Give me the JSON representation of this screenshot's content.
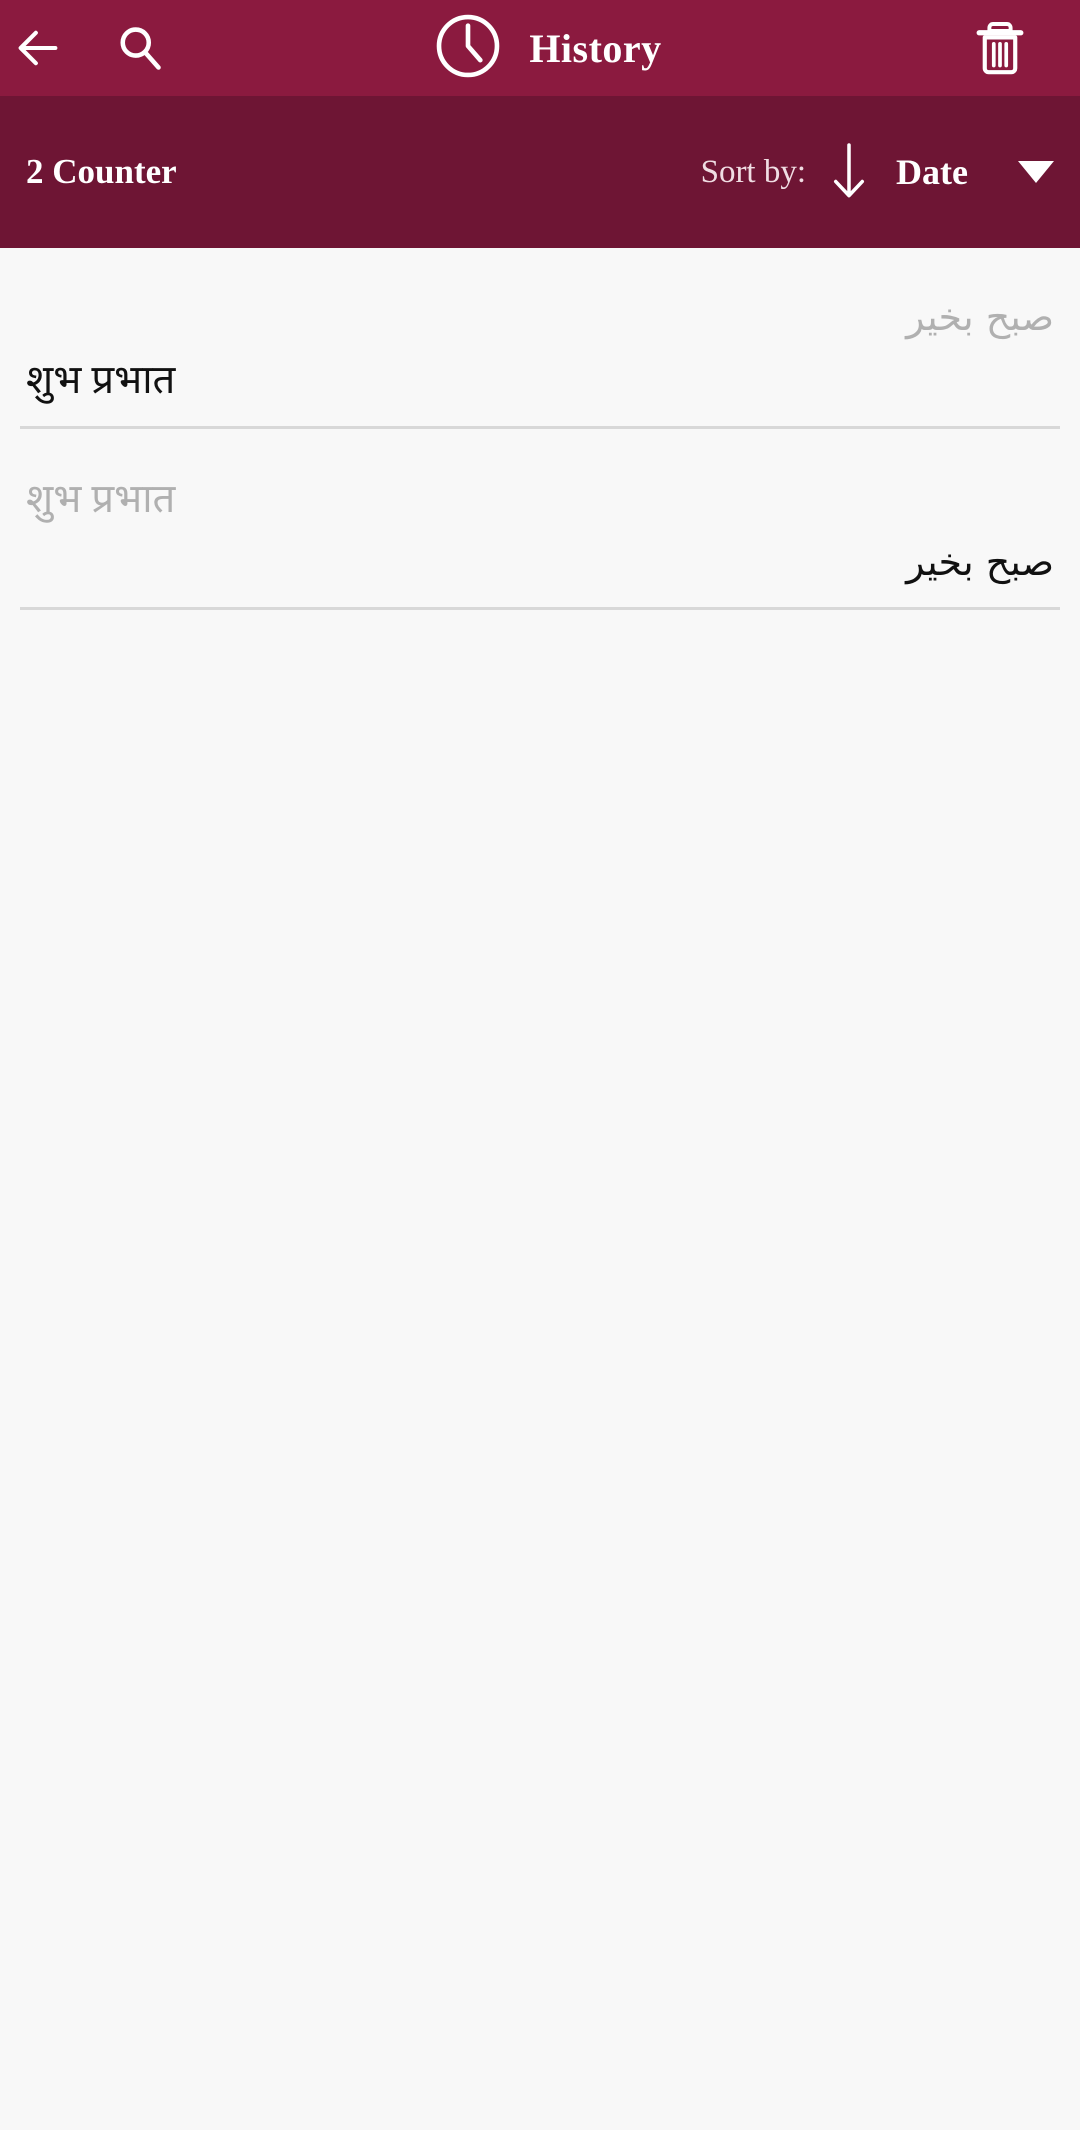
{
  "appbar": {
    "back_icon": "arrow-left-icon",
    "search_icon": "search-icon",
    "clock_icon": "clock-icon",
    "title": "History",
    "delete_icon": "trash-icon",
    "background_color": "#8b1a3f",
    "foreground_color": "#ffffff"
  },
  "sortbar": {
    "counter_label": "2 Counter",
    "sort_by_label": "Sort by:",
    "sort_direction_icon": "arrow-down-icon",
    "sort_field": "Date",
    "dropdown_icon": "caret-down-icon",
    "background_color": "#6e1534"
  },
  "history": {
    "background_color": "#f8f8f8",
    "source_text_color": "#b0b0b0",
    "target_text_color": "#111111",
    "divider_color": "#d8d8d8",
    "items": [
      {
        "source_text": "صبح بخير",
        "source_direction": "rtl",
        "target_text": "शुभ प्रभात",
        "target_direction": "ltr"
      },
      {
        "source_text": "शुभ प्रभात",
        "source_direction": "ltr",
        "target_text": "صبح بخير",
        "target_direction": "rtl"
      }
    ]
  }
}
